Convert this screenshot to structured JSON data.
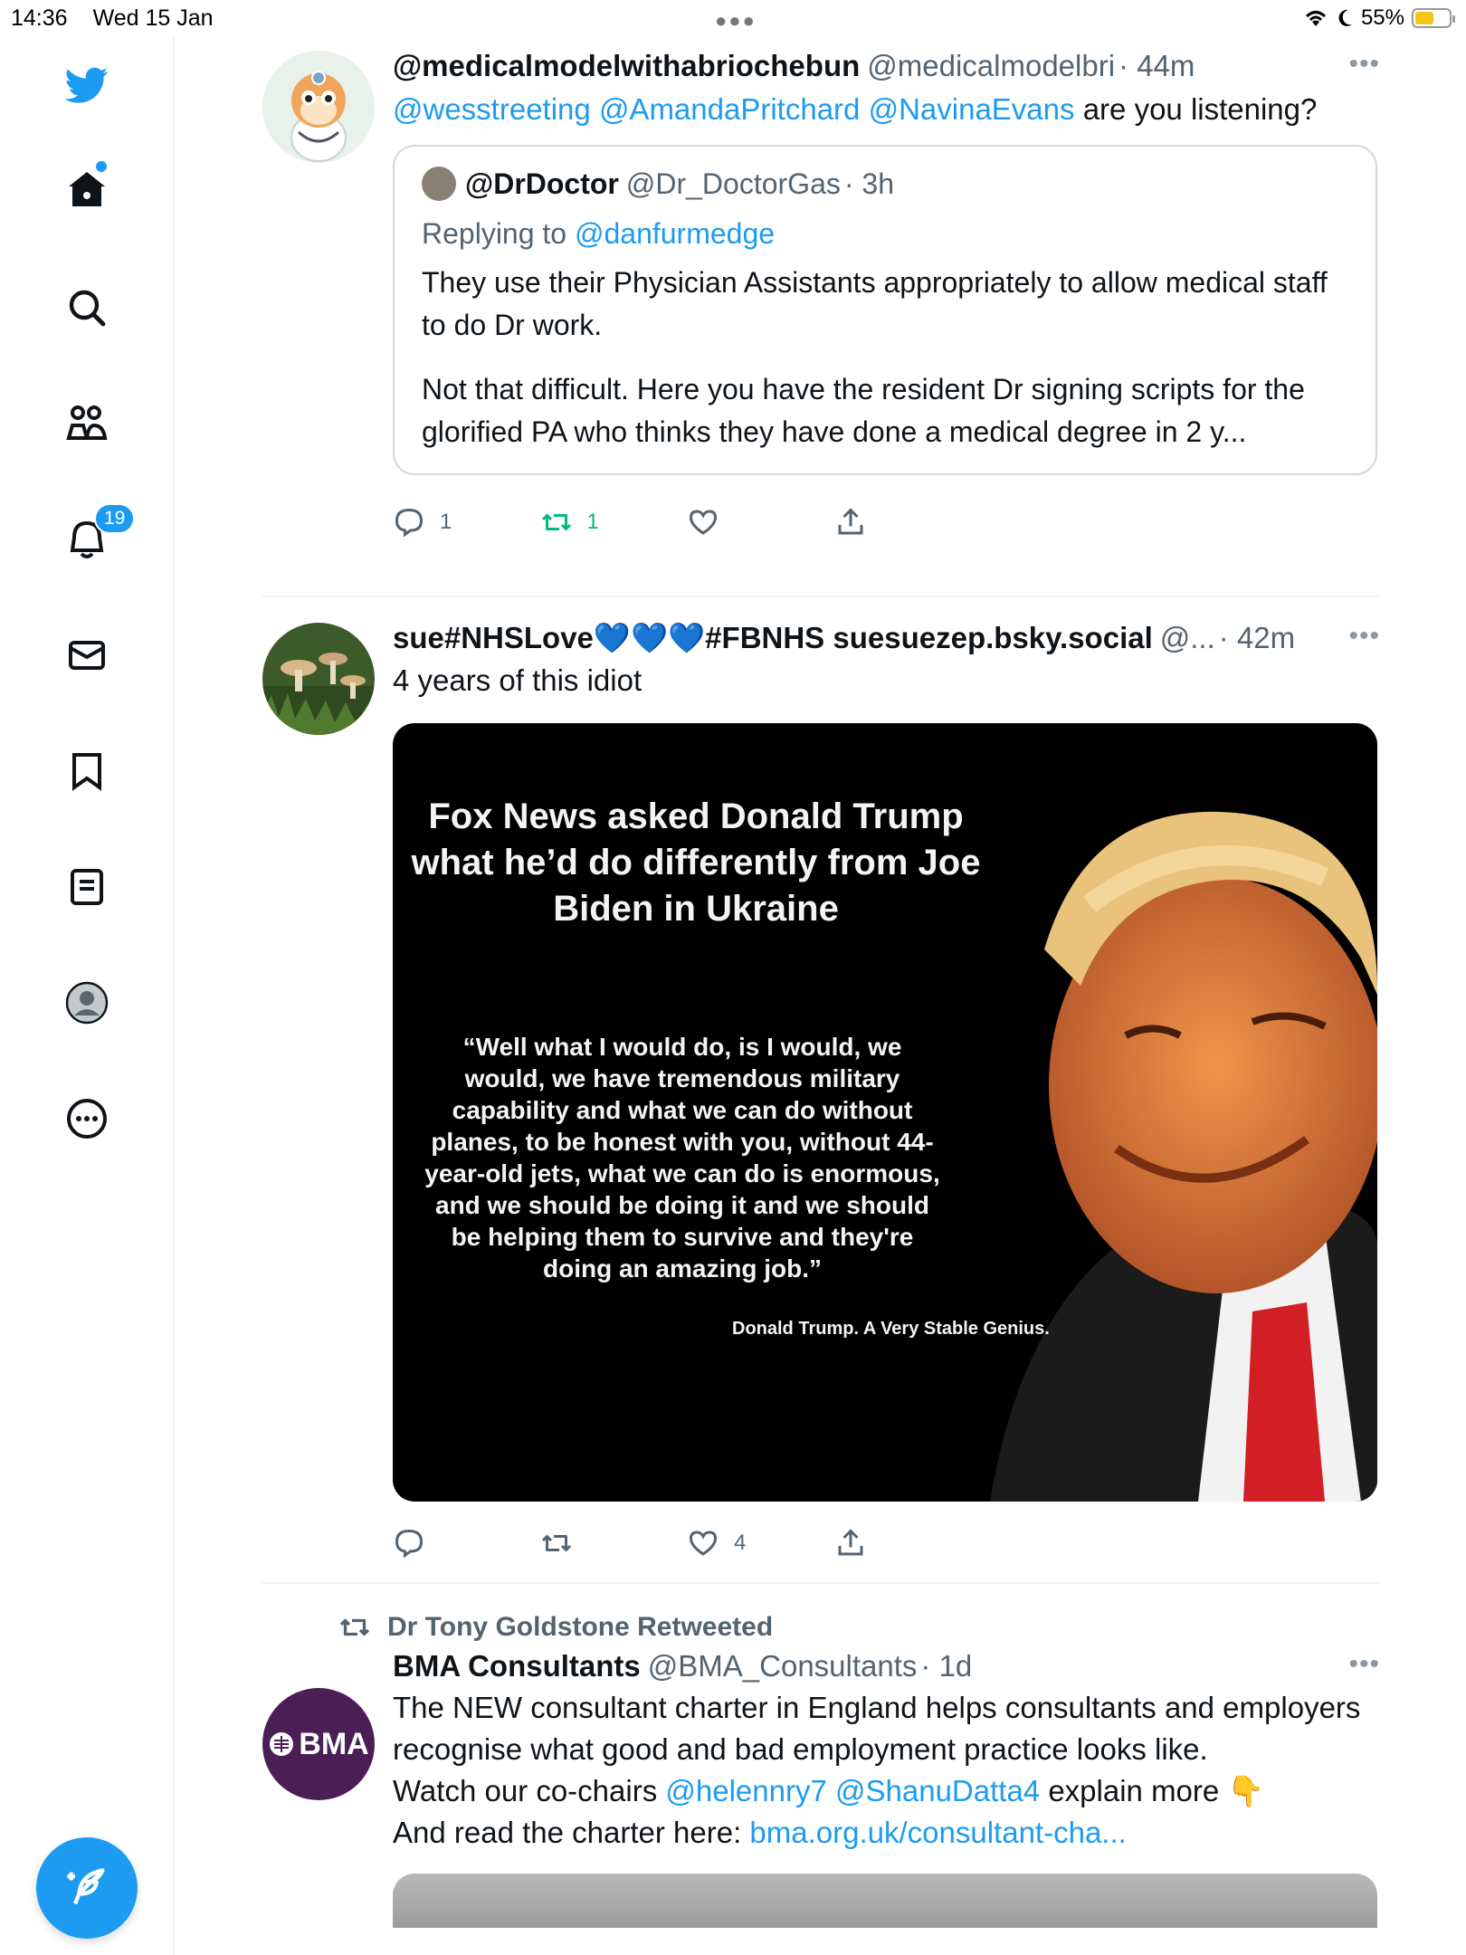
{
  "status_bar": {
    "time": "14:36",
    "date": "Wed 15 Jan",
    "battery": "55%",
    "battery_level": 0.55
  },
  "sidebar": {
    "items": [
      {
        "name": "twitter-logo",
        "icon": "bird-icon"
      },
      {
        "name": "home",
        "icon": "home-icon"
      },
      {
        "name": "explore",
        "icon": "search-icon"
      },
      {
        "name": "communities",
        "icon": "people-icon"
      },
      {
        "name": "notifications",
        "icon": "bell-icon",
        "badge": "19"
      },
      {
        "name": "messages",
        "icon": "mail-icon"
      },
      {
        "name": "bookmarks",
        "icon": "bookmark-icon"
      },
      {
        "name": "lists",
        "icon": "list-icon"
      },
      {
        "name": "profile",
        "icon": "profile-icon"
      },
      {
        "name": "more",
        "icon": "more-circle-icon"
      }
    ],
    "accent": "#1d9bf0"
  },
  "tweets": [
    {
      "name": "@medicalmodelwithabriochebun",
      "handle": "@medicalmodelbri",
      "time": "· 44m",
      "mentions": [
        "@wesstreeting",
        "@AmandaPritchard",
        "@NavinaEvans"
      ],
      "text": "are you listening?",
      "quote": {
        "name": "@DrDoctor",
        "handle": "@Dr_DoctorGas",
        "time": "· 3h",
        "reply_prefix": "Replying to",
        "reply_to": "@danfurmedge",
        "text1": "They use their Physician Assistants appropriately to allow medical staff to do Dr work.",
        "text2": "Not that difficult. Here you have the resident Dr signing scripts for the glorified PA who thinks they have done a medical degree in 2 y..."
      },
      "replies": "1",
      "retweets": "1",
      "likes": ""
    },
    {
      "name": "sue#NHSLove💙💙💙#FBNHS suesuezep.bsky.social",
      "handle": "@...",
      "time": "· 42m",
      "text": "4 years of this idiot",
      "media": {
        "title": "Fox News asked Donald Trump what he’d do differently from Joe Biden in Ukraine",
        "quote": "“Well what I would do, is I would, we would, we have tremendous military capability and what we can do without planes, to be honest with you, without 44-year-old jets, what we can do is enormous, and we should be doing it and we should be helping them to survive and they're doing an amazing job.”",
        "signature": "Donald Trump. A Very Stable Genius."
      },
      "replies": "",
      "retweets": "",
      "likes": "4"
    },
    {
      "retweeted_by": "Dr Tony Goldstone Retweeted",
      "name": "BMA Consultants",
      "handle": "@BMA_Consultants",
      "time": "· 1d",
      "avatar_text": "BMA",
      "text": "The NEW consultant charter in England helps consultants and employers recognise what good and bad employment practice looks like.",
      "line2_prefix": "Watch our co-chairs",
      "line2_mentions": [
        "@helennry7",
        "@ShanuDatta4"
      ],
      "line2_suffix": "explain more 👇",
      "line3_prefix": "And read the charter here:",
      "line3_link": "bma.org.uk/consultant-cha..."
    }
  ],
  "more_glyph": "•••"
}
